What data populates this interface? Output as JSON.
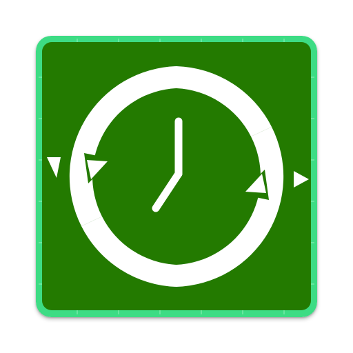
{
  "app_icon": {
    "name": "time-sync-app-icon",
    "icon": "clock-sync-icon",
    "colors": {
      "background": "#237a00",
      "border": "#3ddc84",
      "border_dark": "#2bbf6c",
      "foreground": "#ffffff"
    },
    "clock_time": "7:00"
  }
}
